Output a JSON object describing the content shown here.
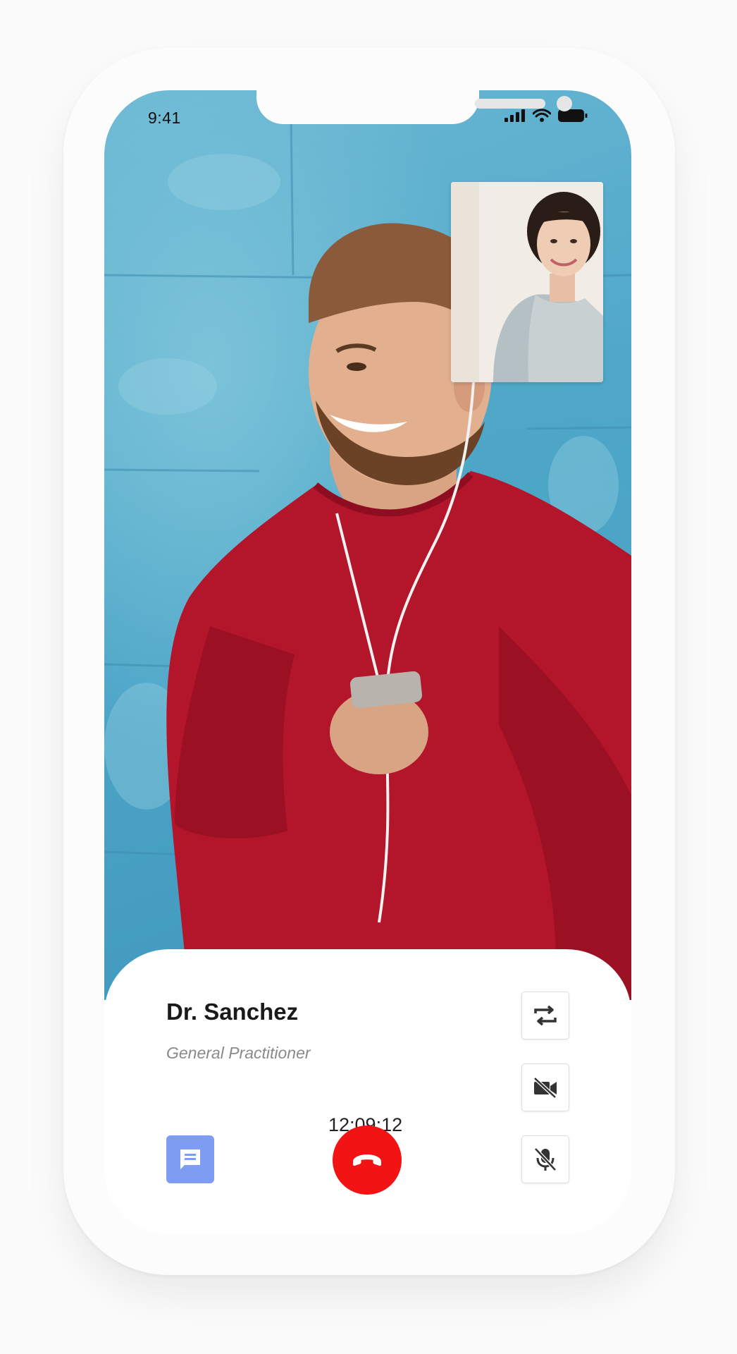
{
  "status_bar": {
    "time": "9:41",
    "icons": [
      "signal-icon",
      "wifi-icon",
      "battery-icon"
    ]
  },
  "remote_video": {
    "description_icon": "remote-participant-video"
  },
  "local_video": {
    "description_icon": "self-preview-video"
  },
  "call_panel": {
    "doctor_name": "Dr. Sanchez",
    "doctor_role": "General Practitioner",
    "call_duration": "12:09:12"
  },
  "controls": {
    "switch_camera_icon": "switch-camera-icon",
    "video_off_icon": "video-off-icon",
    "mute_icon": "mic-off-icon",
    "chat_icon": "chat-icon",
    "end_call_icon": "end-call-icon"
  },
  "colors": {
    "end_call": "#f21414",
    "chat_button": "#7e9cf1",
    "wall_blue": "#4ea7c9",
    "sweater_red": "#b3152a"
  }
}
